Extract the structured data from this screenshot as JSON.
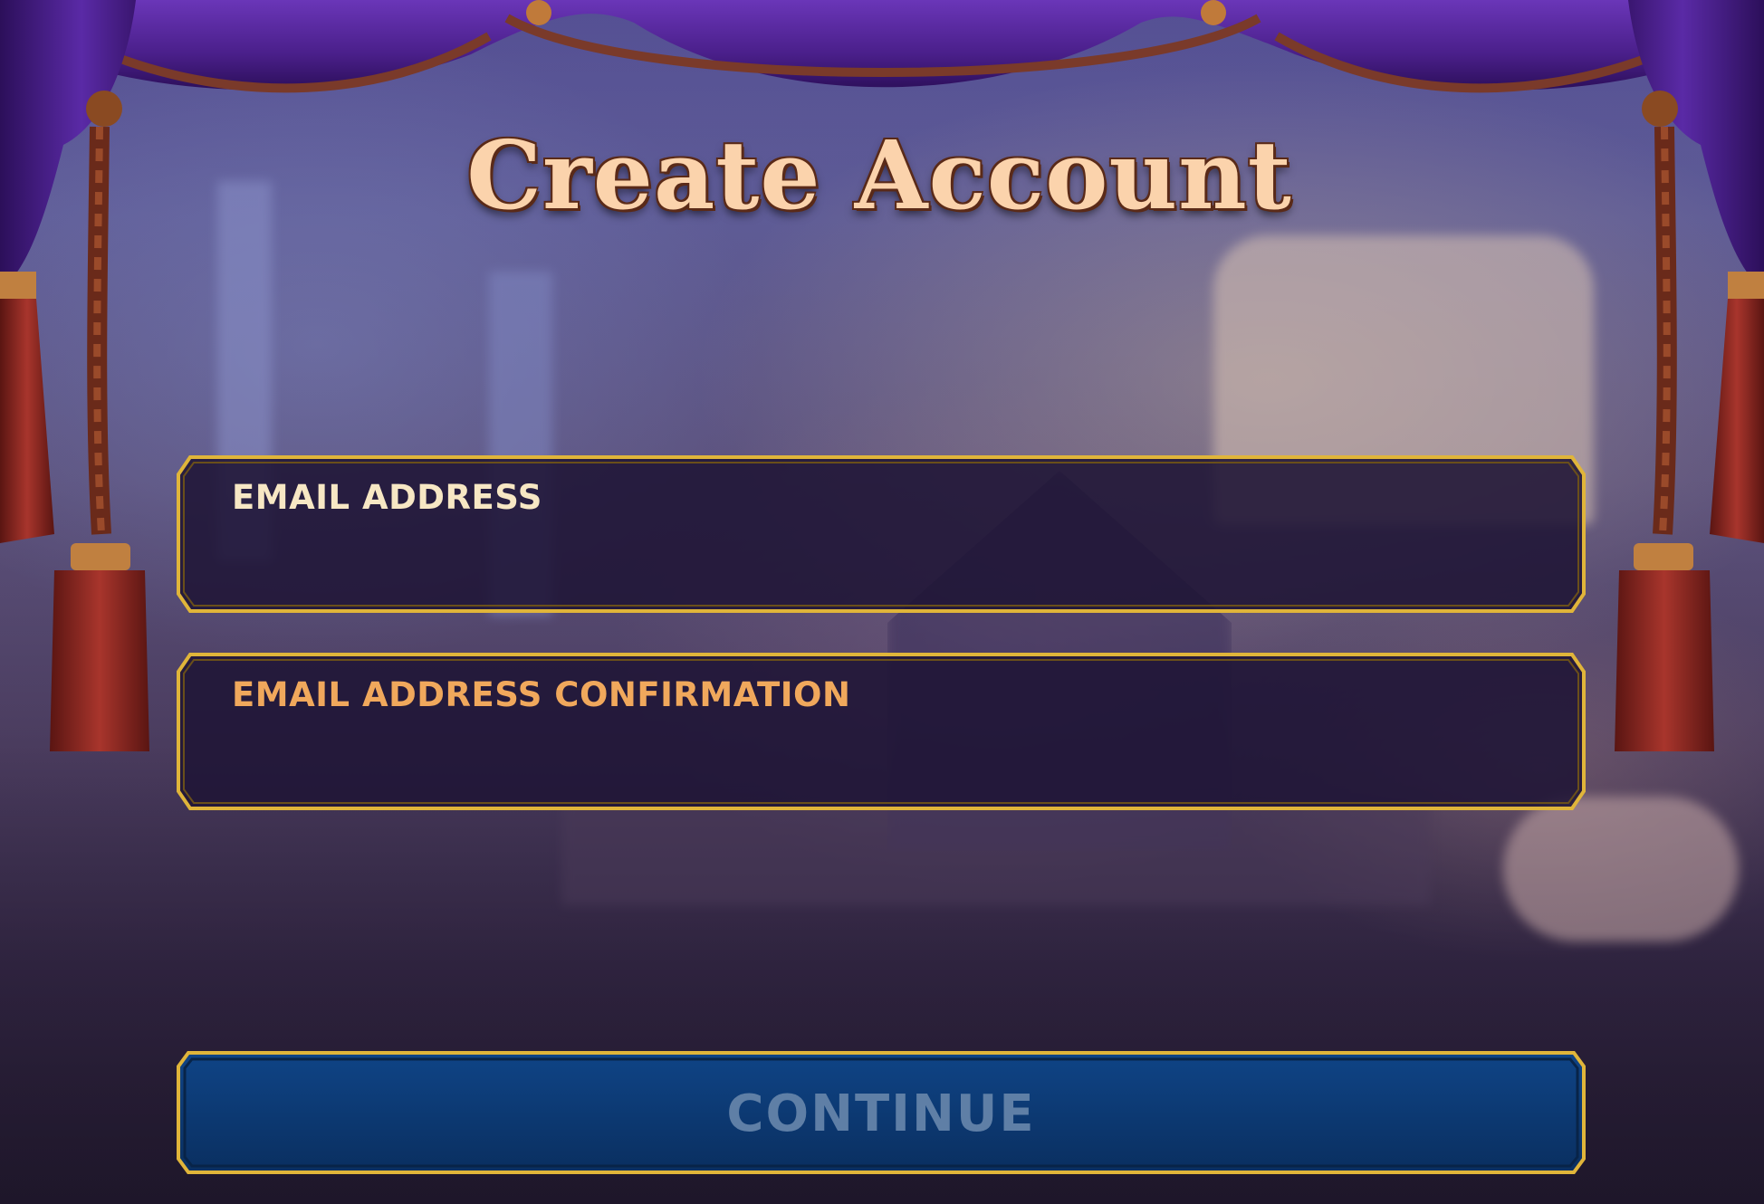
{
  "screen": {
    "title": "Create Account"
  },
  "form": {
    "email": {
      "label": "EMAIL ADDRESS",
      "value": ""
    },
    "email_confirm": {
      "label": "EMAIL ADDRESS CONFIRMATION",
      "value": ""
    }
  },
  "actions": {
    "continue_label": "CONTINUE",
    "continue_state": "disabled"
  },
  "theme": {
    "title_color": "#fbd3ac",
    "frame_gold": "#e0b53a",
    "field_fill": "#1f1535",
    "button_fill": "#0c3a73",
    "curtain_purple": "#4a1f8a",
    "tassel_red": "#8a2a25"
  },
  "icons": [
    "curtain-drape",
    "tassel"
  ]
}
